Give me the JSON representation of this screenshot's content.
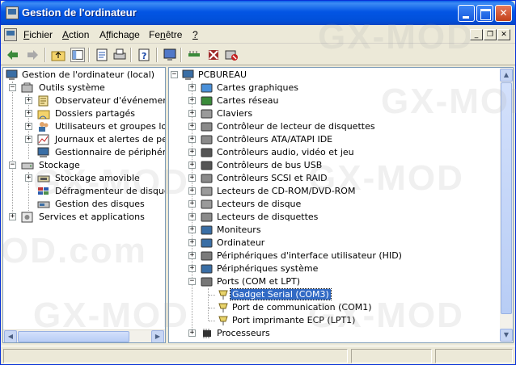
{
  "window": {
    "title": "Gestion de l'ordinateur"
  },
  "menu": {
    "items": [
      {
        "label": "Fichier",
        "key": "F"
      },
      {
        "label": "Action",
        "key": "A"
      },
      {
        "label": "Affichage",
        "key": "f"
      },
      {
        "label": "Fenêtre",
        "key": "n"
      },
      {
        "label": "?",
        "key": "?"
      }
    ]
  },
  "left_tree": {
    "root": "Gestion de l'ordinateur (local)",
    "groups": [
      {
        "label": "Outils système",
        "children": [
          "Observateur d'événements",
          "Dossiers partagés",
          "Utilisateurs et groupes locau:",
          "Journaux et alertes de perfo",
          "Gestionnaire de périphérique"
        ]
      },
      {
        "label": "Stockage",
        "children": [
          "Stockage amovible",
          "Défragmenteur de disque",
          "Gestion des disques"
        ]
      },
      {
        "label": "Services et applications",
        "children": []
      }
    ]
  },
  "right_tree": {
    "root": "PCBUREAU",
    "items": [
      "Cartes graphiques",
      "Cartes réseau",
      "Claviers",
      "Contrôleur de lecteur de disquettes",
      "Contrôleurs ATA/ATAPI IDE",
      "Contrôleurs audio, vidéo et jeu",
      "Contrôleurs de bus USB",
      "Contrôleurs SCSI et RAID",
      "Lecteurs de CD-ROM/DVD-ROM",
      "Lecteurs de disque",
      "Lecteurs de disquettes",
      "Moniteurs",
      "Ordinateur",
      "Périphériques d'interface utilisateur (HID)",
      "Périphériques système",
      "Ports (COM et LPT)"
    ],
    "ports_children": [
      "Gadget Serial (COM3)",
      "Port de communication (COM1)",
      "Port imprimante ECP (LPT1)"
    ],
    "last": "Processeurs",
    "selected": "Gadget Serial (COM3)"
  },
  "watermark": {
    "text": "GX-MOD",
    "subtext": "OD.com"
  },
  "colors": {
    "titlebar": "#0355e4",
    "selection": "#316ac5"
  }
}
